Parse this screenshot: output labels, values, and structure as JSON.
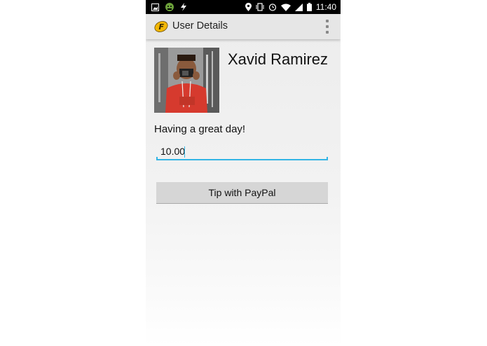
{
  "status_bar": {
    "time": "11:40",
    "left_icons": [
      "image-icon",
      "android-icon",
      "bolt-icon"
    ],
    "right_icons": [
      "location-icon",
      "vibrate-icon",
      "alarm-icon",
      "wifi-icon",
      "signal-icon",
      "battery-icon"
    ]
  },
  "app_bar": {
    "title": "User Details",
    "logo_icon": "app-logo-icon",
    "menu_icon": "overflow-menu-icon"
  },
  "profile": {
    "name": "Xavid Ramirez",
    "status_message": "Having a great day!"
  },
  "tip": {
    "amount_value": "10.00",
    "button_label": "Tip with PayPal"
  },
  "colors": {
    "accent": "#33b5e5",
    "appbar": "#e6e6e6",
    "button": "#d6d6d6"
  }
}
